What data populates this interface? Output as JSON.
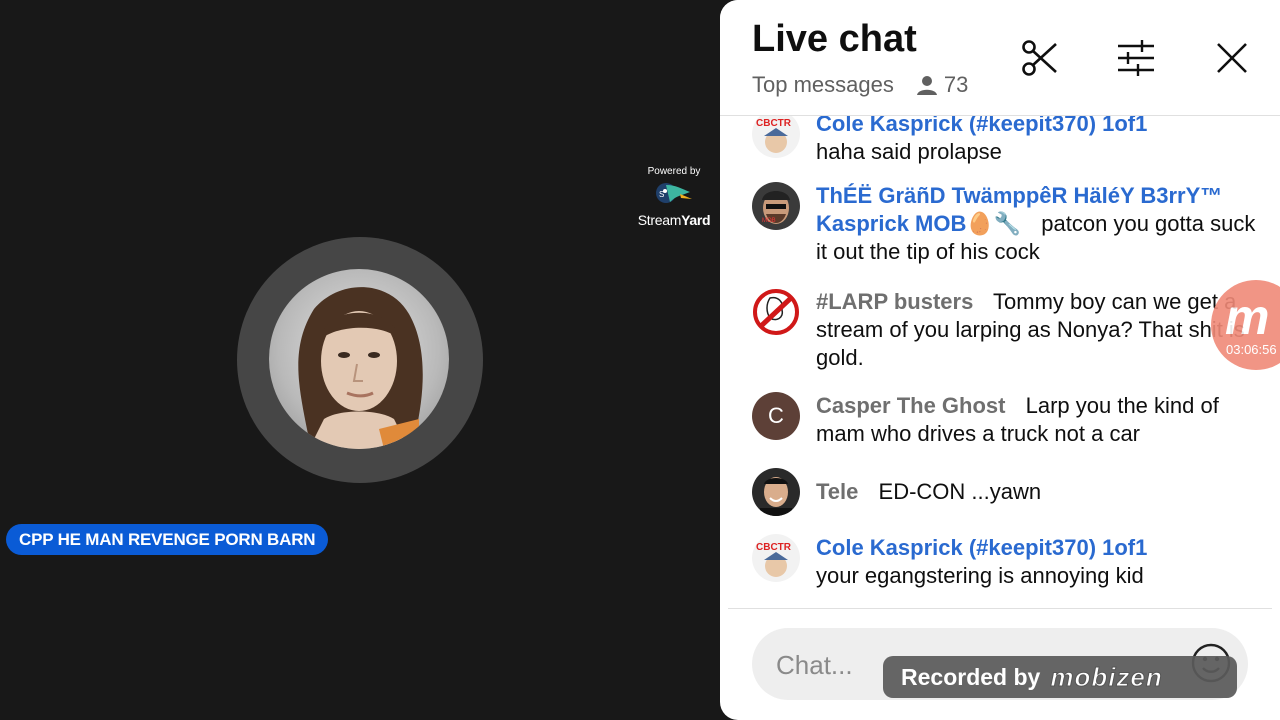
{
  "video": {
    "powered_by": "Powered by",
    "brand_part1": "Stream",
    "brand_part2": "Yard",
    "name_tag": "CPP HE MAN REVENGE PORN BARN"
  },
  "chat": {
    "title": "Live chat",
    "mode": "Top messages",
    "viewer_count": "73",
    "messages": [
      {
        "author": "Cole Kasprick (#keepit370) 1of1",
        "text": "haha said prolapse"
      },
      {
        "author": "ThÉË GräñD TwämppêR HäléY B3rrY™ Kasprick MOB🥚🔧",
        "text": "patcon you gotta suck it out the tip of his cock"
      },
      {
        "author": "#LARP busters",
        "text": "Tommy boy can we get a stream of you larping as Nonya? That shit is gold."
      },
      {
        "author": "Casper The Ghost",
        "text": "Larp you the kind of mam who drives a truck not a car",
        "avatar_letter": "C"
      },
      {
        "author": "Tele",
        "text": "ED-CON ...yawn"
      },
      {
        "author": "Cole Kasprick (#keepit370) 1of1",
        "text": "your egangstering is annoying kid"
      }
    ],
    "input_placeholder": "Chat..."
  },
  "overlay": {
    "recorded_by": "Recorded by",
    "recorder_brand": "mobizen",
    "float_timer": "03:06:56",
    "float_letter": "m"
  },
  "colors": {
    "name_tag_bg": "#0a5bd6",
    "author_blue": "#2a6ad0",
    "author_gray": "#6f6f6f",
    "panel_bg": "#ffffff",
    "video_bg": "#181818"
  }
}
